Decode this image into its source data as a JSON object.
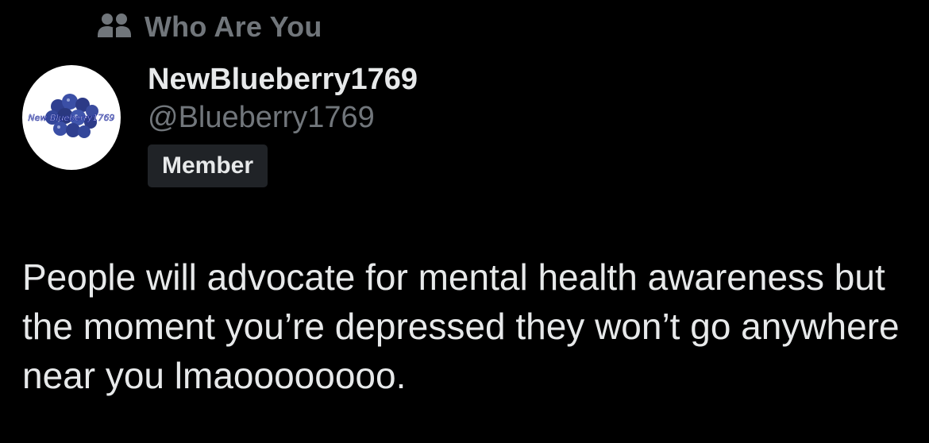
{
  "community": {
    "icon": "people-icon",
    "label": "Who Are You"
  },
  "author": {
    "avatar_caption": "New Blueberry1769",
    "display_name": "NewBlueberry1769",
    "handle": "@Blueberry1769",
    "badge": "Member"
  },
  "post": {
    "text": "People will advocate for mental health awareness but the moment you’re depressed they won’t go anywhere near you lmaoooooooo."
  },
  "colors": {
    "background": "#000000",
    "primary_text": "#e7e9ea",
    "secondary_text": "#71767b",
    "badge_bg": "#202327",
    "blueberry": "#3b4fa6"
  }
}
